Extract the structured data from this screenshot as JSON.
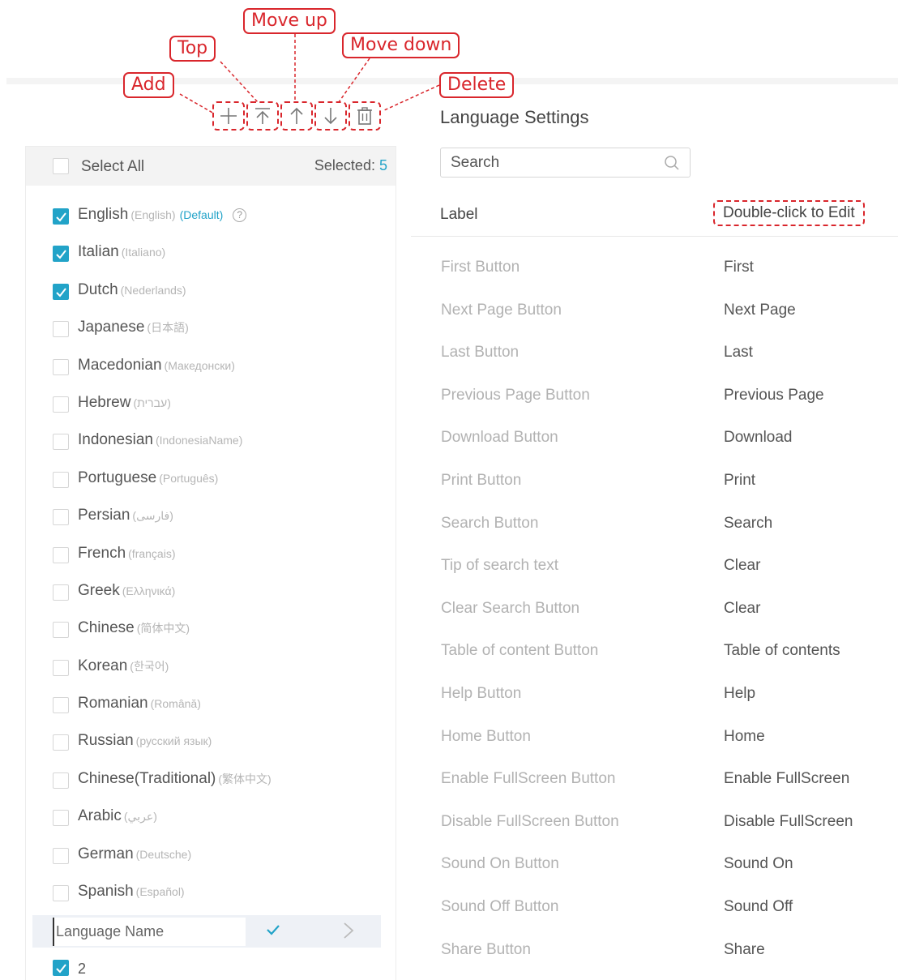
{
  "callouts": {
    "add": "Add",
    "top": "Top",
    "move_up": "Move up",
    "move_down": "Move down",
    "delete": "Delete"
  },
  "toolbar": {
    "icons": [
      "plus-icon",
      "move-to-top-icon",
      "arrow-up-icon",
      "arrow-down-icon",
      "trash-icon"
    ]
  },
  "left": {
    "select_all": "Select All",
    "selected_label": "Selected:",
    "selected_count": "5",
    "languages": [
      {
        "name": "English",
        "native": "(English)",
        "default": "(Default)",
        "help": "?",
        "checked": true
      },
      {
        "name": "Italian",
        "native": "(Italiano)",
        "checked": true
      },
      {
        "name": "Dutch",
        "native": "(Nederlands)",
        "checked": true
      },
      {
        "name": "Japanese",
        "native": "(日本語)",
        "checked": false
      },
      {
        "name": "Macedonian",
        "native": "(Македонски)",
        "checked": false
      },
      {
        "name": "Hebrew",
        "native": "(עברית)",
        "checked": false
      },
      {
        "name": "Indonesian",
        "native": "(IndonesiaName)",
        "checked": false
      },
      {
        "name": "Portuguese",
        "native": "(Português)",
        "checked": false
      },
      {
        "name": "Persian",
        "native": "(فارسی)",
        "checked": false
      },
      {
        "name": "French",
        "native": "(français)",
        "checked": false
      },
      {
        "name": "Greek",
        "native": "(Ελληνικά)",
        "checked": false
      },
      {
        "name": "Chinese",
        "native": "(简体中文)",
        "checked": false
      },
      {
        "name": "Korean",
        "native": "(한국어)",
        "checked": false
      },
      {
        "name": "Romanian",
        "native": "(Română)",
        "checked": false
      },
      {
        "name": "Russian",
        "native": "(русский язык)",
        "checked": false
      },
      {
        "name": "Chinese(Traditional)",
        "native": "(繁体中文)",
        "checked": false
      },
      {
        "name": "Arabic",
        "native": "(عربي)",
        "checked": false
      },
      {
        "name": "German",
        "native": "(Deutsche)",
        "checked": false
      },
      {
        "name": "Spanish",
        "native": "(Español)",
        "checked": false
      }
    ],
    "new_language_placeholder": "Language Name",
    "new_entry": {
      "name": "2",
      "checked": true
    }
  },
  "right": {
    "title": "Language Settings",
    "search_placeholder": "Search",
    "col_label": "Label",
    "col_edit_hint": "Double-click to Edit",
    "rows": [
      {
        "label": "First Button",
        "value": "First"
      },
      {
        "label": "Next Page Button",
        "value": "Next Page"
      },
      {
        "label": "Last Button",
        "value": "Last"
      },
      {
        "label": "Previous Page Button",
        "value": "Previous Page"
      },
      {
        "label": "Download Button",
        "value": "Download"
      },
      {
        "label": "Print Button",
        "value": "Print"
      },
      {
        "label": "Search Button",
        "value": "Search"
      },
      {
        "label": "Tip of search text",
        "value": "Clear"
      },
      {
        "label": "Clear Search Button",
        "value": "Clear"
      },
      {
        "label": "Table of content Button",
        "value": "Table of contents"
      },
      {
        "label": "Help Button",
        "value": "Help"
      },
      {
        "label": "Home Button",
        "value": "Home"
      },
      {
        "label": "Enable FullScreen Button",
        "value": "Enable FullScreen"
      },
      {
        "label": "Disable FullScreen Button",
        "value": "Disable FullScreen"
      },
      {
        "label": "Sound On Button",
        "value": "Sound On"
      },
      {
        "label": "Sound Off Button",
        "value": "Sound Off"
      },
      {
        "label": "Share Button",
        "value": "Share"
      }
    ]
  },
  "colors": {
    "accent": "#22a3c8",
    "callout": "#d9262c",
    "muted_text": "#b2b2b2"
  }
}
